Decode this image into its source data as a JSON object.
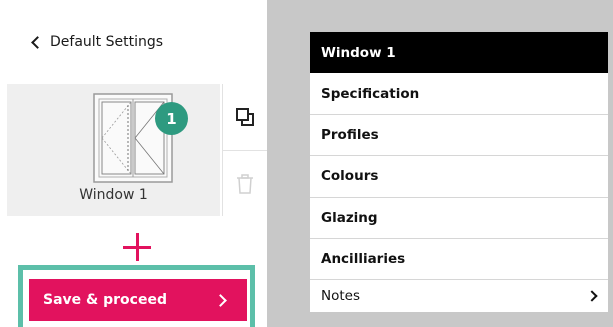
{
  "header": {
    "back_label": "Default Settings"
  },
  "window_card": {
    "label": "Window 1",
    "badge": "1"
  },
  "actions": {
    "duplicate_icon": "duplicate-icon",
    "delete_icon": "trash-icon",
    "add_icon": "plus-icon"
  },
  "save": {
    "label": "Save & proceed"
  },
  "menu": {
    "items": [
      {
        "label": "Window 1"
      },
      {
        "label": "Specification"
      },
      {
        "label": "Profiles"
      },
      {
        "label": "Colours"
      },
      {
        "label": "Glazing"
      },
      {
        "label": "Ancilliaries"
      },
      {
        "label": "Notes"
      }
    ]
  },
  "colors": {
    "accent": "#e2125e",
    "badge": "#2e9a80",
    "highlight_frame": "#5cbfa9",
    "panel_bg": "#c8c8c8",
    "active_bg": "#000000"
  }
}
